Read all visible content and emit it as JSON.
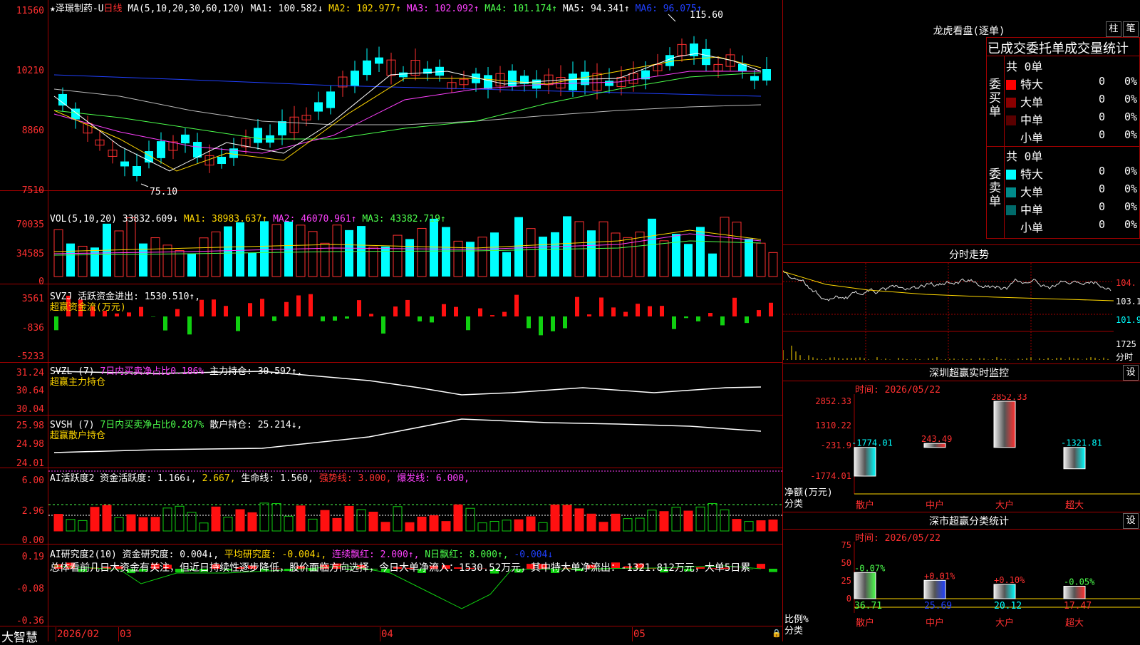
{
  "stock": {
    "name": "★泽璟制药-U",
    "period": "日线"
  },
  "main_indicator": {
    "label": "MA(5,10,20,30,60,120)",
    "ma1": "MA1: 100.582↓",
    "ma2": "MA2: 102.977↑",
    "ma3": "MA3: 102.092↑",
    "ma4": "MA4: 101.174↑",
    "ma5": "MA5: 94.341↑",
    "ma6": "MA6: 96.075↑",
    "high_mark": "115.60",
    "low_mark": "75.10",
    "y_ticks": [
      "11560",
      "10210",
      "8860",
      "7510"
    ]
  },
  "vol_indicator": {
    "label": "VOL(5,10,20)",
    "value": "33832.609↓",
    "ma1": "MA1: 38983.637↑",
    "ma2": "MA2: 46070.961↑",
    "ma3": "MA3: 43382.719↑",
    "y_ticks": [
      "70035",
      "34585",
      "0"
    ]
  },
  "svzj": {
    "label": "SVZJ  活跃资金进出: ",
    "value": "1530.510↑,",
    "sub": "超赢资金流(万元)",
    "y_ticks": [
      "3561",
      "-836",
      "-5233"
    ]
  },
  "svzl": {
    "label": "SVZL (7)",
    "pct": "7日内买卖净占比0.186%",
    "hold": "主力持仓: 30.592↑,",
    "sub": "超赢主力持仓",
    "y_ticks": [
      "31.24",
      "30.64",
      "30.04"
    ]
  },
  "svsh": {
    "label": "SVSH (7)",
    "pct": "7日内买卖净占比0.287%",
    "hold": "散户持仓: 25.214↓,",
    "sub": "超赢散户持仓",
    "y_ticks": [
      "25.98",
      "24.98",
      "24.01"
    ]
  },
  "ai_active": {
    "label": "AI活跃度2 资金活跃度: 1.166↓,",
    "v2": "2.667,",
    "life": "生命线: 1.560,",
    "strong": "强势线: 3.000,",
    "burst": "爆发线: 6.000,",
    "y_ticks": [
      "6.00",
      "2.96",
      "0.00"
    ]
  },
  "ai_research": {
    "label": "AI研究度2(10) 资金研究度: 0.004↓,",
    "avg": "平均研究度: -0.004↓,",
    "streak": "连续飘红: 2.000↑,",
    "nday": "N日飘红: 8.000↑,",
    "last": "-0.004↓",
    "y_ticks": [
      "0.19",
      "-0.08",
      "-0.36"
    ],
    "comment": "总体看前几日大资金有关注，但近日持续性逐步降低，股价面临方向选择，今日大单净流入：1530.52万元，其中特大单净流出：-1321.812万元，大单5日累"
  },
  "bottom_bar": {
    "brand": "大智慧",
    "date_start": "2026/02",
    "months": [
      "03",
      "04",
      "05"
    ]
  },
  "dragon": {
    "title": "龙虎看盘(逐单)",
    "btn1": "柱",
    "btn2": "笔",
    "header": "已成交委托单成交量统计",
    "buy_label": "委买单",
    "sell_label": "委卖单",
    "buy_total": "共 0单",
    "sell_total": "共 0单",
    "buy_rows": [
      {
        "name": "特大",
        "count": "0",
        "pct": "0%",
        "color": "#ff0000"
      },
      {
        "name": "大单",
        "count": "0",
        "pct": "0%",
        "color": "#8b0000"
      },
      {
        "name": "中单",
        "count": "0",
        "pct": "0%",
        "color": "#5a0000"
      },
      {
        "name": "小单",
        "count": "0",
        "pct": "0%",
        "color": "#000000"
      }
    ],
    "sell_rows": [
      {
        "name": "特大",
        "count": "0",
        "pct": "0%",
        "color": "#00ffff"
      },
      {
        "name": "大单",
        "count": "0",
        "pct": "0%",
        "color": "#008b8b"
      },
      {
        "name": "中单",
        "count": "0",
        "pct": "0%",
        "color": "#006a6a"
      },
      {
        "name": "小单",
        "count": "0",
        "pct": "0%",
        "color": "#000000"
      }
    ]
  },
  "intraday": {
    "title": "分时走势",
    "y_labels": [
      "104.",
      "103.1",
      "101.9"
    ],
    "vol_label": "1725",
    "vol_unit": "分时"
  },
  "monitor": {
    "title": "深圳超赢实时监控",
    "btn": "设",
    "time": "时间: 2026/05/22",
    "y_ticks": [
      "2852.33",
      "1310.22",
      "-231.9",
      "-1774.01"
    ],
    "unit": "净额(万元)",
    "cat": "分类",
    "bars": [
      {
        "label": "散户",
        "value": -1774.01,
        "text": "-1774.01",
        "color": "#00ffff"
      },
      {
        "label": "中户",
        "value": 243.49,
        "text": "243.49",
        "color": "#ff3030"
      },
      {
        "label": "大户",
        "value": 2852.33,
        "text": "2852.33",
        "color": "#ff3030"
      },
      {
        "label": "超大",
        "value": -1321.81,
        "text": "-1321.81",
        "color": "#00ffff"
      }
    ]
  },
  "classify": {
    "title": "深市超赢分类统计",
    "btn": "设",
    "time": "时间: 2026/05/22",
    "y_ticks": [
      "75",
      "50",
      "25",
      "0"
    ],
    "unit": "比例%",
    "cat": "分类",
    "bars": [
      {
        "label": "散户",
        "value": 36.71,
        "text": "36.71",
        "change": "-0.07%",
        "color": "#4cff4c"
      },
      {
        "label": "中户",
        "value": 25.69,
        "text": "25.69",
        "change": "+0.01%",
        "color": "#2040ff"
      },
      {
        "label": "大户",
        "value": 20.12,
        "text": "20.12",
        "change": "+0.10%",
        "color": "#00ffff"
      },
      {
        "label": "超大",
        "value": 17.47,
        "text": "17.47",
        "change": "-0.05%",
        "color": "#ff3030"
      }
    ]
  }
}
